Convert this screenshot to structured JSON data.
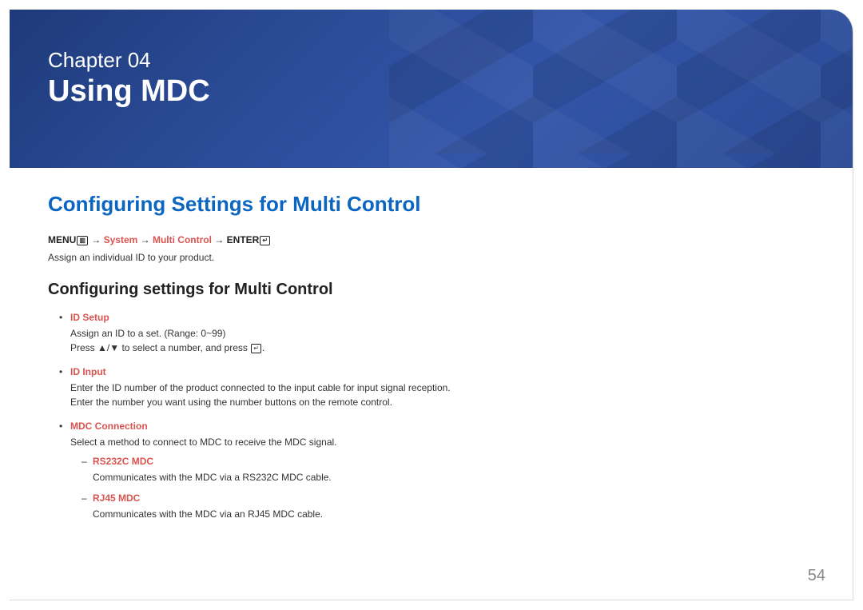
{
  "hero": {
    "chapter_label": "Chapter  04",
    "chapter_title": "Using MDC"
  },
  "section": {
    "heading": "Configuring Settings for Multi Control",
    "nav_menu": "MENU",
    "nav_arrow": "→",
    "nav_system": "System",
    "nav_multi_control": "Multi Control",
    "nav_enter": "ENTER",
    "assign_text": "Assign an individual ID to your product.",
    "subheading": "Configuring settings for Multi Control"
  },
  "items": {
    "id_setup": {
      "title": "ID Setup",
      "line1": "Assign an ID to a set. (Range: 0~99)",
      "line2_a": "Press ",
      "line2_b": " to select a number, and press ",
      "line2_c": "."
    },
    "id_input": {
      "title": "ID Input",
      "line1": "Enter the ID number of the product connected to the input cable for input signal reception.",
      "line2": "Enter the number you want using the number buttons on the remote control."
    },
    "mdc_connection": {
      "title": "MDC Connection",
      "line1": "Select a method to connect to MDC to receive the MDC signal.",
      "rs232c": {
        "title": "RS232C MDC",
        "desc": "Communicates with the MDC via a RS232C MDC cable."
      },
      "rj45": {
        "title": "RJ45 MDC",
        "desc": "Communicates with the MDC via an RJ45 MDC cable."
      }
    }
  },
  "page_number": "54",
  "icons": {
    "menu_glyph": "▥",
    "enter_glyph": "↵",
    "updown_glyph": "▲/▼"
  }
}
